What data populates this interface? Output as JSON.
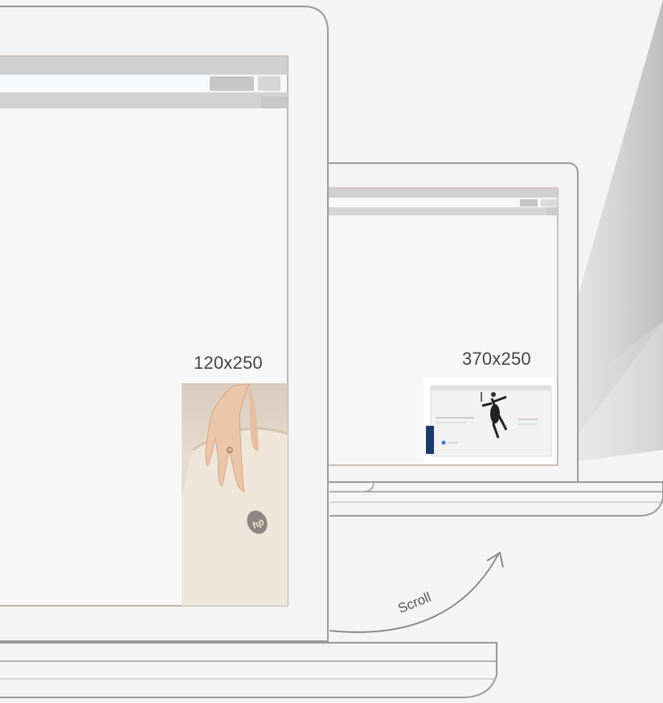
{
  "labels": {
    "small_ad_size": "120x250",
    "large_ad_size": "370x250",
    "scroll": "Scroll"
  },
  "colors": {
    "background": "#f4f4f4",
    "laptop_outline": "#9a9a9a",
    "browser_bar": "#cfcfcf",
    "light_beam": "#c9c9c9"
  },
  "icons": {
    "scroll_arrow": "curved-arrow-up-right",
    "brand_logo": "hp-logo"
  }
}
